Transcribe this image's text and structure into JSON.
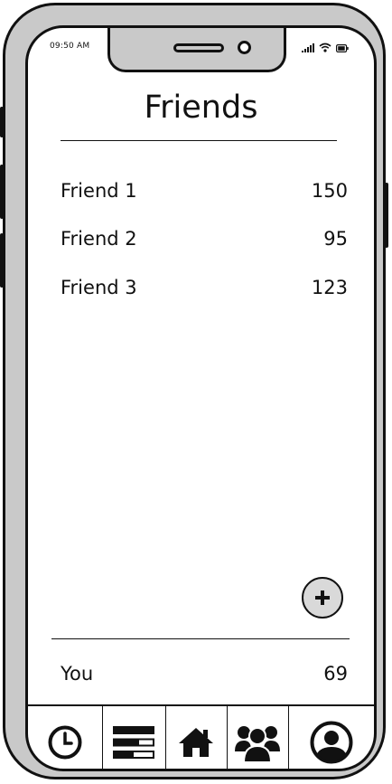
{
  "status_bar": {
    "time": "09:50 AM"
  },
  "page": {
    "title": "Friends"
  },
  "friends": [
    {
      "name": "Friend 1",
      "score": "150"
    },
    {
      "name": "Friend 2",
      "score": "95"
    },
    {
      "name": "Friend 3",
      "score": "123"
    }
  ],
  "add_button": {
    "icon": "plus-icon"
  },
  "me": {
    "name": "You",
    "score": "69"
  },
  "tabs": [
    {
      "icon": "clock-icon"
    },
    {
      "icon": "list-icon"
    },
    {
      "icon": "home-icon"
    },
    {
      "icon": "friends-icon",
      "active": true
    },
    {
      "icon": "profile-icon"
    }
  ]
}
